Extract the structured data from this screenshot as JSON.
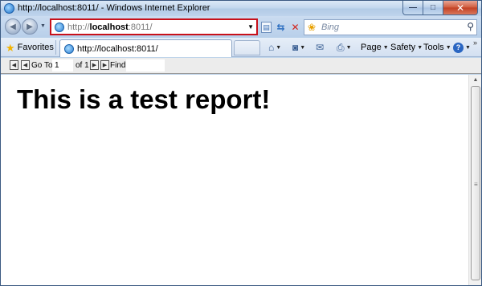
{
  "window": {
    "title": "http://localhost:8011/ - Windows Internet Explorer",
    "min_glyph": "—",
    "max_glyph": "□",
    "close_glyph": "✕"
  },
  "nav": {
    "address_prefix": "http://",
    "address_host": "localhost",
    "address_suffix": ":8011/",
    "search_placeholder": "Bing"
  },
  "favorites_bar": {
    "favorites_label": "Favorites",
    "tab_label": "http://localhost:8011/"
  },
  "command_bar": {
    "page_label": "Page",
    "safety_label": "Safety",
    "tools_label": "Tools"
  },
  "report_toolbar": {
    "goto_label": "Go To:",
    "goto_value": "1",
    "of_label": "of 1",
    "find_label": "Find:",
    "find_value": ""
  },
  "report": {
    "heading": "This is a test report!"
  },
  "colors": {
    "address_border": "#c8101a",
    "frame": "#bcd3ea"
  },
  "icons": [
    "ie-icon",
    "back-arrow-icon",
    "forward-arrow-icon",
    "compatibility-view-icon",
    "refresh-icon",
    "stop-icon",
    "bing-icon",
    "search-icon",
    "star-icon",
    "home-icon",
    "feeds-icon",
    "mail-icon",
    "print-icon",
    "help-icon"
  ]
}
